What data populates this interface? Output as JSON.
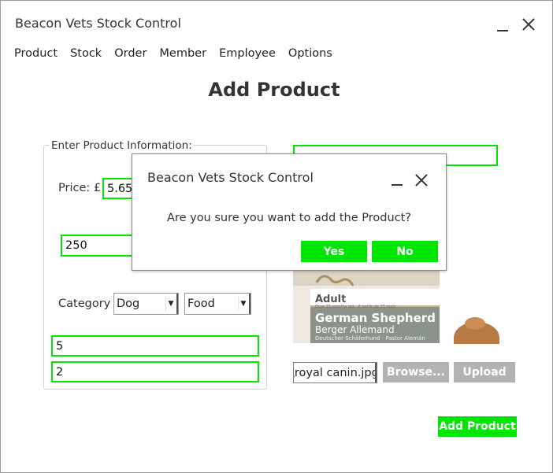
{
  "window": {
    "title": "Beacon Vets Stock Control"
  },
  "menu": [
    "Product",
    "Stock",
    "Order",
    "Member",
    "Employee",
    "Options"
  ],
  "page_title": "Add Product",
  "form": {
    "group_label": "Enter Product Information:",
    "price_label": "Price: £",
    "price_value": "5.65",
    "quantity_value": "250",
    "category_label": "Category",
    "category_animal": "Dog",
    "category_type": "Food",
    "field_a_value": "5",
    "field_b_value": "2"
  },
  "name_field_value": "",
  "product_image": {
    "line1": "Adult",
    "line2": "Over 15 months old · A partir de 15 mois",
    "line3": "German Shepherd",
    "line4": "Berger Allemand",
    "line5": "Deutscher Schäferhund · Pastor Alemán"
  },
  "file": {
    "filename": "\\royal canin.jpg",
    "browse_label": "Browse...",
    "upload_label": "Upload"
  },
  "add_product_label": "Add Product",
  "dialog": {
    "title": "Beacon Vets Stock Control",
    "message": "Are you sure you want to add the Product?",
    "yes_label": "Yes",
    "no_label": "No"
  },
  "colors": {
    "accent_green": "#00e600",
    "button_grey": "#b3b3b3"
  }
}
